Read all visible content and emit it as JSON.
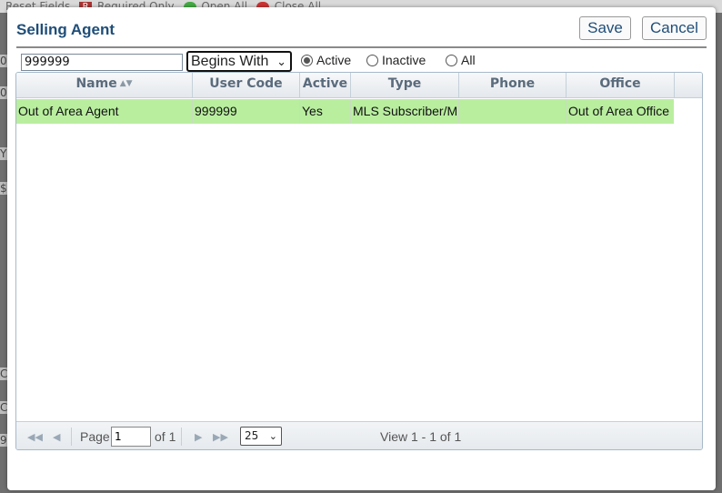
{
  "background": {
    "toolbar_items": [
      "Reset Fields",
      "Required Only",
      "Open All",
      "Close All"
    ],
    "required_badge": "R",
    "left_glyphs": [
      "0",
      "0",
      "Y",
      "$",
      "C",
      "C",
      "9"
    ]
  },
  "dialog": {
    "title": "Selling Agent",
    "save_label": "Save",
    "cancel_label": "Cancel"
  },
  "filter": {
    "search_value": "999999",
    "match_mode": "Begins With",
    "match_chevron": "⌄",
    "status_options": [
      {
        "label": "Active",
        "checked": true
      },
      {
        "label": "Inactive",
        "checked": false
      },
      {
        "label": "All",
        "checked": false
      }
    ]
  },
  "grid": {
    "sort_icon": "▲▼",
    "columns": [
      "Name",
      "User Code",
      "Active",
      "Type",
      "Phone",
      "Office"
    ],
    "rows": [
      [
        "Out of Area Agent",
        "999999",
        "Yes",
        "MLS Subscriber/ML",
        "",
        "Out of Area Office"
      ]
    ],
    "row_color": "#b9ee9f"
  },
  "pager": {
    "first_icon": "◀◀",
    "prev_icon": "◀",
    "next_icon": "▶",
    "last_icon": "▶▶",
    "page_label": "Page",
    "page_value": "1",
    "of_label": "of 1",
    "rows_per_page": "25",
    "rows_chevron": "⌄",
    "view_text": "View 1 - 1 of 1"
  }
}
